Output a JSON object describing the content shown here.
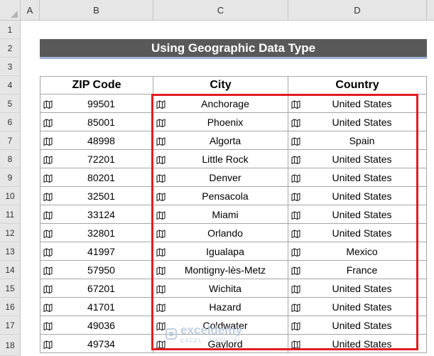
{
  "columns": [
    "A",
    "B",
    "C",
    "D"
  ],
  "rows": [
    "1",
    "2",
    "3",
    "4",
    "5",
    "6",
    "7",
    "8",
    "9",
    "10",
    "11",
    "12",
    "13",
    "14",
    "15",
    "16",
    "17",
    "18"
  ],
  "title": "Using Geographic Data Type",
  "headers": {
    "zip": "ZIP Code",
    "city": "City",
    "country": "Country"
  },
  "data": [
    {
      "zip": "99501",
      "city": "Anchorage",
      "country": "United States"
    },
    {
      "zip": "85001",
      "city": "Phoenix",
      "country": "United States"
    },
    {
      "zip": "48998",
      "city": "Algorta",
      "country": "Spain"
    },
    {
      "zip": "72201",
      "city": "Little Rock",
      "country": "United States"
    },
    {
      "zip": "80201",
      "city": "Denver",
      "country": "United States"
    },
    {
      "zip": "32501",
      "city": "Pensacola",
      "country": "United States"
    },
    {
      "zip": "33124",
      "city": "Miami",
      "country": "United States"
    },
    {
      "zip": "32801",
      "city": "Orlando",
      "country": "United States"
    },
    {
      "zip": "41997",
      "city": "Igualapa",
      "country": "Mexico"
    },
    {
      "zip": "57950",
      "city": "Montigny-lès-Metz",
      "country": "France"
    },
    {
      "zip": "67201",
      "city": "Wichita",
      "country": "United States"
    },
    {
      "zip": "41701",
      "city": "Hazard",
      "country": "United States"
    },
    {
      "zip": "49036",
      "city": "Coldwater",
      "country": "United States"
    },
    {
      "zip": "49734",
      "city": "Gaylord",
      "country": "United States"
    }
  ],
  "watermark": {
    "name": "exceldemy",
    "tagline": "EXCEL · DATA · BI"
  },
  "icon": "map-data-type-icon",
  "colors": {
    "title_bg": "#595959",
    "title_underline": "#9eb4d8",
    "selection_border": "#e21b23"
  }
}
